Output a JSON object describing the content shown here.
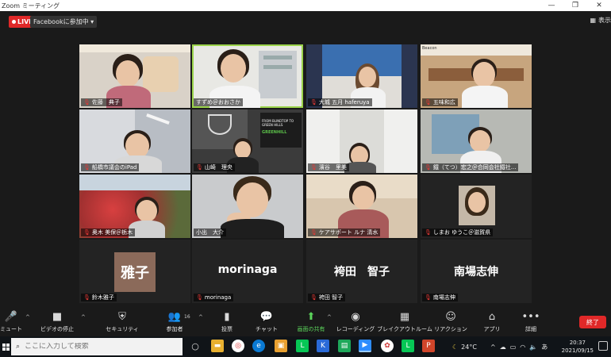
{
  "window": {
    "title": "Zoom ミーティング",
    "minimize": "—",
    "maximize": "❐",
    "close": "✕"
  },
  "topbar": {
    "live_label": "LIVE",
    "facebook_status": "Facebookに参加中 ▾",
    "view_label": "表示"
  },
  "participants": [
    {
      "name": "佐藤　典子"
    },
    {
      "name": "すずめ＠おおさか"
    },
    {
      "name": "大城 五月 haferuya"
    },
    {
      "name": "五味和広"
    },
    {
      "name": "船橋市議会のiPad"
    },
    {
      "name": "山崎　理央"
    },
    {
      "name": "濱谷　里美"
    },
    {
      "name": "鐵（てつ）宏之＠合同会社鐵社..."
    },
    {
      "name": "奥木 美保＠栃木"
    },
    {
      "name": "小出　大介"
    },
    {
      "name": "ケアサポート ルナ 清水"
    },
    {
      "name": "しまお ゆうこ＠滋賀県"
    },
    {
      "name": "鈴木雅子",
      "display": "雅子"
    },
    {
      "name": "morinaga",
      "display": "morinaga"
    },
    {
      "name": "袴田 智子",
      "display": "袴田　智子"
    },
    {
      "name": "南場志伸",
      "display": "南場志伸"
    }
  ],
  "tile_texts": {
    "gym_sign": "FROM BLINDTOP TO GREEN HILLS",
    "gym_sign_green": "GREENHILL",
    "room_sign": "Beacon"
  },
  "toolbar": {
    "mute": "ミュート",
    "video": "ビデオの停止",
    "security": "セキュリティ",
    "participants": "参加者",
    "participants_count": "16",
    "poll": "投票",
    "chat": "チャット",
    "share": "画面の共有",
    "record": "レコーディング",
    "breakout": "ブレイクアウトルーム",
    "reaction": "リアクション",
    "apps": "アプリ",
    "more": "詳細",
    "end": "終了"
  },
  "taskbar": {
    "search_placeholder": "ここに入力して検索",
    "weather": "24°C",
    "ime": "あ",
    "time": "20:37",
    "date": "2021/09/15"
  },
  "colors": {
    "live": "#e02828",
    "share": "#5cd65c",
    "active_speaker": "#9bd44b",
    "end": "#e02828"
  }
}
